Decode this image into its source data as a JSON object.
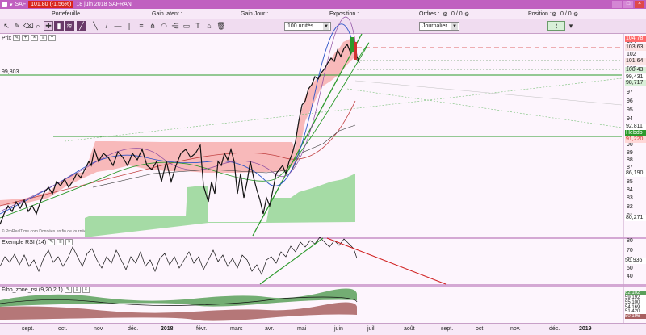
{
  "titlebar": {
    "icon": "saf-icon",
    "symbol": "SAF",
    "quote": "101,80 (-1,56%)",
    "date_name": "18 juin 2018 SAFRAN"
  },
  "labels": {
    "portefeuille": "Portefeuille",
    "gain_latent": "Gain latent :",
    "gain_jour": "Gain Jour :",
    "exposition": "Exposition :",
    "ordres": "Ordres :",
    "ordres_val": "0 / 0",
    "position": "Position :",
    "position_val": "0 / 0"
  },
  "toolbar": {
    "quantity": "100 unités",
    "period": "Journalier"
  },
  "price_panel": {
    "title": "Prix",
    "left_value": "99,803",
    "ticks": [
      "104",
      "102",
      "100",
      "98",
      "97",
      "96",
      "95",
      "94",
      "93",
      "90",
      "89",
      "88",
      "87",
      "85",
      "84",
      "83",
      "82",
      "81"
    ],
    "boxes": [
      {
        "label": "104,78",
        "color": "#ff6a6a",
        "text": "#fff"
      },
      {
        "label": "103,63",
        "color": "#fbe4e4",
        "text": "#222"
      },
      {
        "label": "101,64",
        "color": "#fbe4e4",
        "text": "#222"
      },
      {
        "label": "100,43",
        "color": "#d8f0d8",
        "text": "#222"
      },
      {
        "label": "99,431",
        "color": "#ffffff",
        "text": "#222"
      },
      {
        "label": "98,717",
        "color": "#d8f0d8",
        "text": "#222"
      },
      {
        "label": "92,811",
        "color": "#ffffff",
        "text": "#222"
      },
      {
        "label": "Hebdo",
        "color": "#2c9a2c",
        "text": "#fff"
      },
      {
        "label": "91,220",
        "color": "#ffd8d8",
        "text": "#d03030"
      },
      {
        "label": "86,190",
        "color": "#ffffff",
        "text": "#222"
      },
      {
        "label": "80,271",
        "color": "#ffffff",
        "text": "#222"
      }
    ],
    "watermark": "© ProRealTime.com Données en fin de journée"
  },
  "rsi_panel": {
    "title": "Exemple RSI (14)",
    "ticks": [
      "80",
      "70",
      "60",
      "50",
      "40"
    ],
    "value": "56,936"
  },
  "fibo_panel": {
    "title": "Fibo_zone_rsi (9,20,2,1)",
    "values": [
      "62,102",
      "59,192",
      "55,100",
      "54,169",
      "51,420",
      "50,196"
    ]
  },
  "xaxis": [
    "sept.",
    "oct.",
    "nov.",
    "déc.",
    "2018",
    "févr.",
    "mars",
    "avr.",
    "mai",
    "juin",
    "juil.",
    "août",
    "sept.",
    "oct.",
    "nov.",
    "déc.",
    "2019"
  ],
  "colors": {
    "accent": "#c060c0",
    "up": "#2c9a2c",
    "down": "#d03030"
  }
}
